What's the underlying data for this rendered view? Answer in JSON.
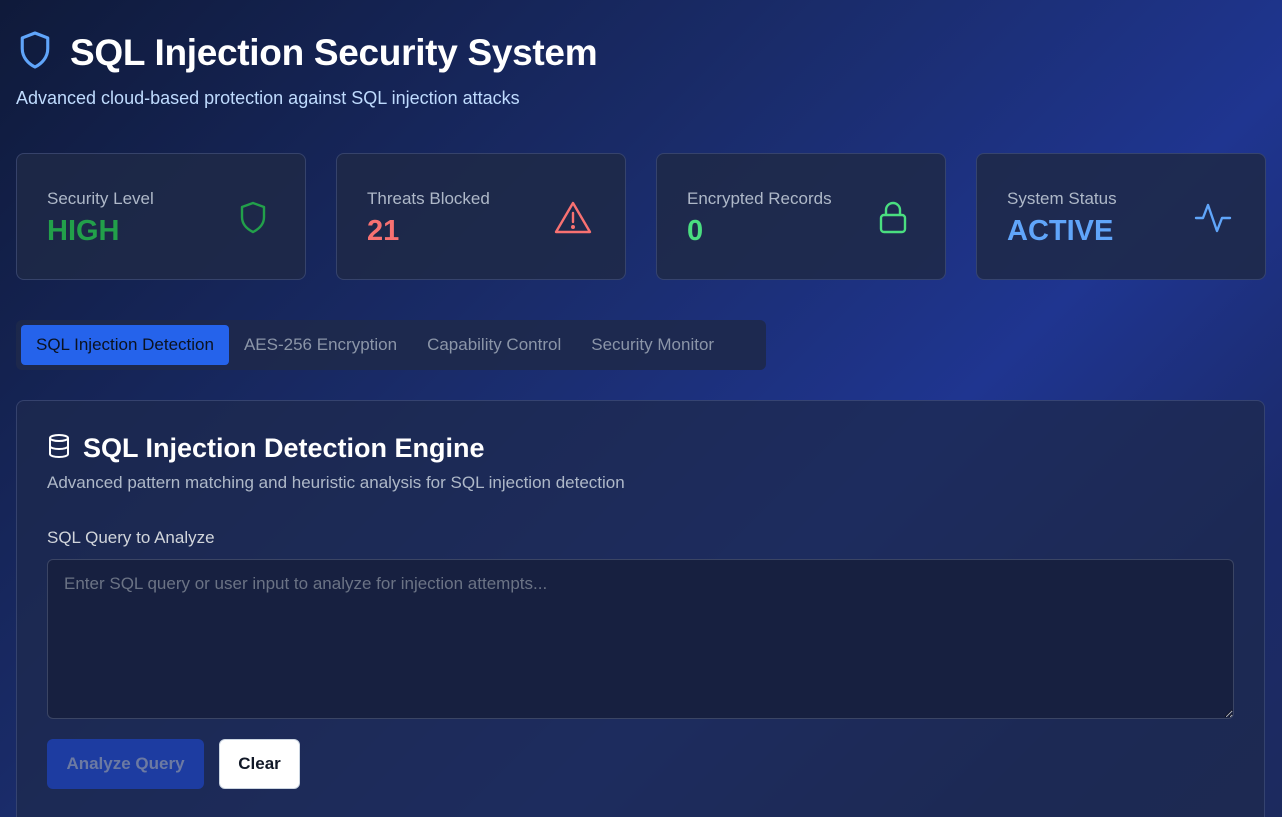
{
  "header": {
    "title": "SQL Injection Security System",
    "subtitle": "Advanced cloud-based protection against SQL injection attacks",
    "icon": "shield-icon"
  },
  "stats": [
    {
      "label": "Security Level",
      "value": "HIGH",
      "icon": "shield-icon",
      "color": "#22a04a"
    },
    {
      "label": "Threats Blocked",
      "value": "21",
      "icon": "warning-triangle-icon",
      "color": "#f87171"
    },
    {
      "label": "Encrypted Records",
      "value": "0",
      "icon": "lock-icon",
      "color": "#4ade80"
    },
    {
      "label": "System Status",
      "value": "ACTIVE",
      "icon": "activity-icon",
      "color": "#60a5fa"
    }
  ],
  "tabs": [
    {
      "label": "SQL Injection Detection",
      "active": true
    },
    {
      "label": "AES-256 Encryption",
      "active": false
    },
    {
      "label": "Capability Control",
      "active": false
    },
    {
      "label": "Security Monitor",
      "active": false
    }
  ],
  "panel": {
    "title": "SQL Injection Detection Engine",
    "icon": "database-icon",
    "description": "Advanced pattern matching and heuristic analysis for SQL injection detection",
    "field_label": "SQL Query to Analyze",
    "query_value": "",
    "query_placeholder": "Enter SQL query or user input to analyze for injection attempts...",
    "analyze_label": "Analyze Query",
    "clear_label": "Clear"
  },
  "colors": {
    "accent": "#2563eb",
    "header_icon": "#60a5fa"
  }
}
